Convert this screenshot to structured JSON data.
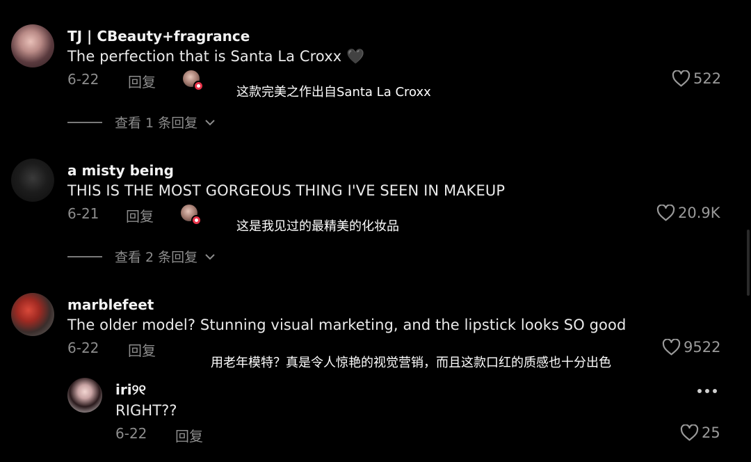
{
  "comments": [
    {
      "username": "TJ | CBeauty+fragrance",
      "text": "The perfection that is Santa La Croxx 🖤",
      "date": "6-22",
      "reply_label": "回复",
      "translation": "这款完美之作出自Santa La Croxx",
      "likes": "522",
      "view_replies": "查看 1 条回复"
    },
    {
      "username": "a misty being",
      "text": "THIS IS THE MOST GORGEOUS THING I'VE SEEN IN MAKEUP",
      "date": "6-21",
      "reply_label": "回复",
      "translation": "这是我见过的最精美的化妆品",
      "likes": "20.9K",
      "view_replies": "查看 2 条回复"
    },
    {
      "username": "marblefeet",
      "text": "The older model? Stunning visual marketing, and the lipstick looks SO good",
      "date": "6-22",
      "reply_label": "回复",
      "translation": "用老年模特？真是令人惊艳的视觉营销，而且这款口红的质感也十分出色",
      "likes": "9522"
    }
  ],
  "reply": {
    "username": "iri୨୧",
    "text": "RIGHT??",
    "date": "6-22",
    "reply_label": "回复",
    "likes": "25"
  },
  "icons": {
    "like": "heart-outline-icon",
    "expand": "chevron-down-icon",
    "more": "more-horizontal-icon"
  },
  "colors": {
    "background": "#000000",
    "muted": "#8d8d8d",
    "text": "#eaeaea",
    "badge": "#e8344a"
  }
}
